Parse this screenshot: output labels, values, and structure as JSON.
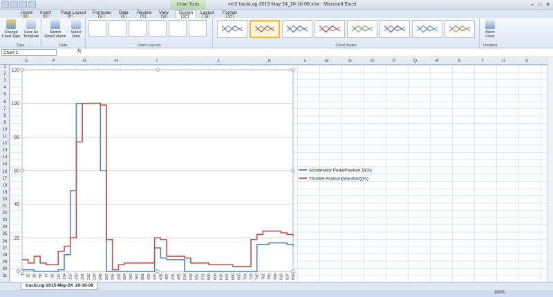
{
  "window": {
    "title": "ver2 trackLog-2015-May-24_20-16-08.xlsx - Microsoft Excel",
    "context_tab": "Chart Tools",
    "controls": [
      "–",
      "□",
      "✕"
    ]
  },
  "tabs": [
    {
      "label": "Home",
      "keytip": "H"
    },
    {
      "label": "Insert",
      "keytip": "N"
    },
    {
      "label": "Page Layout",
      "keytip": "P"
    },
    {
      "label": "Formulas",
      "keytip": "M"
    },
    {
      "label": "Data",
      "keytip": "A"
    },
    {
      "label": "Review",
      "keytip": "R"
    },
    {
      "label": "View",
      "keytip": "W"
    },
    {
      "label": "Design",
      "keytip": "JC",
      "active": true
    },
    {
      "label": "Layout",
      "keytip": "JA"
    },
    {
      "label": "Format",
      "keytip": "JO"
    }
  ],
  "ribbon": {
    "type_group": {
      "label": "Type",
      "buttons": [
        "Change Chart Type",
        "Save As Template"
      ]
    },
    "data_group": {
      "label": "Data",
      "buttons": [
        "Switch Row/Column",
        "Select Data"
      ]
    },
    "layouts_group": {
      "label": "Chart Layouts"
    },
    "styles_group": {
      "label": "Chart Styles",
      "style_colors": [
        "#7f7f9f",
        "#c0504d",
        "#4f81bd",
        "#c0504d",
        "#9bbb59",
        "#8064a2",
        "#4bacc6",
        "#f79646"
      ]
    },
    "location_group": {
      "label": "Location",
      "buttons": [
        "Move Chart"
      ]
    }
  },
  "formula_bar": {
    "name_box": "Chart 1",
    "fx": "fx"
  },
  "columns": [
    "A",
    "F",
    "G",
    "H",
    "I",
    "J",
    "K",
    "L",
    "M",
    "N",
    "O",
    "P",
    "Q",
    "R",
    "S",
    "T",
    "U",
    "V"
  ],
  "rows": [
    "1",
    "2",
    "3",
    "4",
    "5",
    "6",
    "7",
    "8",
    "9",
    "10",
    "11",
    "12",
    "13",
    "14",
    "15",
    "16",
    "17",
    "18",
    "19",
    "20",
    "21",
    "22",
    "23",
    "24",
    "25",
    "26",
    "27",
    "28",
    "29",
    "30",
    "31"
  ],
  "sheet_tab": "trackLog-2015-May-24_20-16-08",
  "status": {
    "zoom": "100%"
  },
  "chart_data": {
    "type": "line",
    "title": "",
    "ylim": [
      0,
      120
    ],
    "yticks": [
      0,
      20,
      40,
      60,
      80,
      100,
      120
    ],
    "x_tick_labels": [
      "1",
      "20",
      "39",
      "58",
      "77",
      "96",
      "115",
      "134",
      "153",
      "172",
      "191",
      "210",
      "229",
      "248",
      "267",
      "286",
      "305",
      "324",
      "343",
      "362",
      "381",
      "400",
      "419",
      "438",
      "457",
      "476",
      "495",
      "514",
      "533",
      "552",
      "571",
      "590",
      "609",
      "628",
      "647",
      "666",
      "685",
      "704",
      "723",
      "742",
      "761",
      "780",
      "799",
      "818",
      "837",
      "856"
    ],
    "x": [
      1,
      20,
      39,
      58,
      77,
      96,
      115,
      134,
      153,
      172,
      191,
      210,
      229,
      248,
      267,
      286,
      305,
      324,
      343,
      362,
      381,
      400,
      419,
      438,
      457,
      476,
      495,
      514,
      533,
      552,
      571,
      590,
      609,
      628,
      647,
      666,
      685,
      704,
      723,
      742,
      761,
      780,
      799,
      818,
      837,
      856
    ],
    "grid": true,
    "legend_position": "right",
    "series": [
      {
        "name": "Accelerator PedalPosition D(%)",
        "color": "#4f81bd",
        "values": [
          1,
          1,
          0,
          0,
          0,
          0,
          1,
          10,
          48,
          100,
          100,
          100,
          100,
          60,
          0,
          0,
          0,
          0,
          0,
          0,
          0,
          0,
          14,
          8,
          7,
          7,
          7,
          0,
          0,
          0,
          0,
          0,
          0,
          0,
          0,
          0,
          0,
          0,
          0,
          16,
          16,
          17,
          17,
          17,
          16,
          15
        ]
      },
      {
        "name": "Throttle Position(Manifold)(%)",
        "color": "#c0504d",
        "values": [
          7,
          5,
          9,
          5,
          4,
          4,
          12,
          15,
          20,
          77,
          100,
          100,
          100,
          99,
          19,
          1,
          4,
          5,
          5,
          5,
          5,
          5,
          20,
          19,
          9,
          9,
          9,
          8,
          5,
          5,
          5,
          4,
          4,
          4,
          4,
          3,
          3,
          3,
          19,
          22,
          24,
          24,
          24,
          23,
          22,
          21
        ]
      }
    ]
  }
}
